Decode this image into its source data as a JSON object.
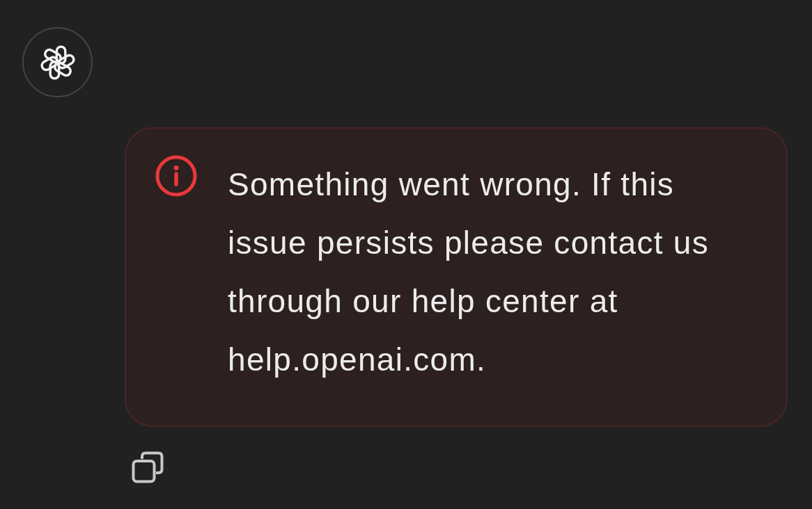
{
  "error_message": {
    "text": "Something went wrong. If this issue persists please contact us through our help center at help.openai.com."
  }
}
